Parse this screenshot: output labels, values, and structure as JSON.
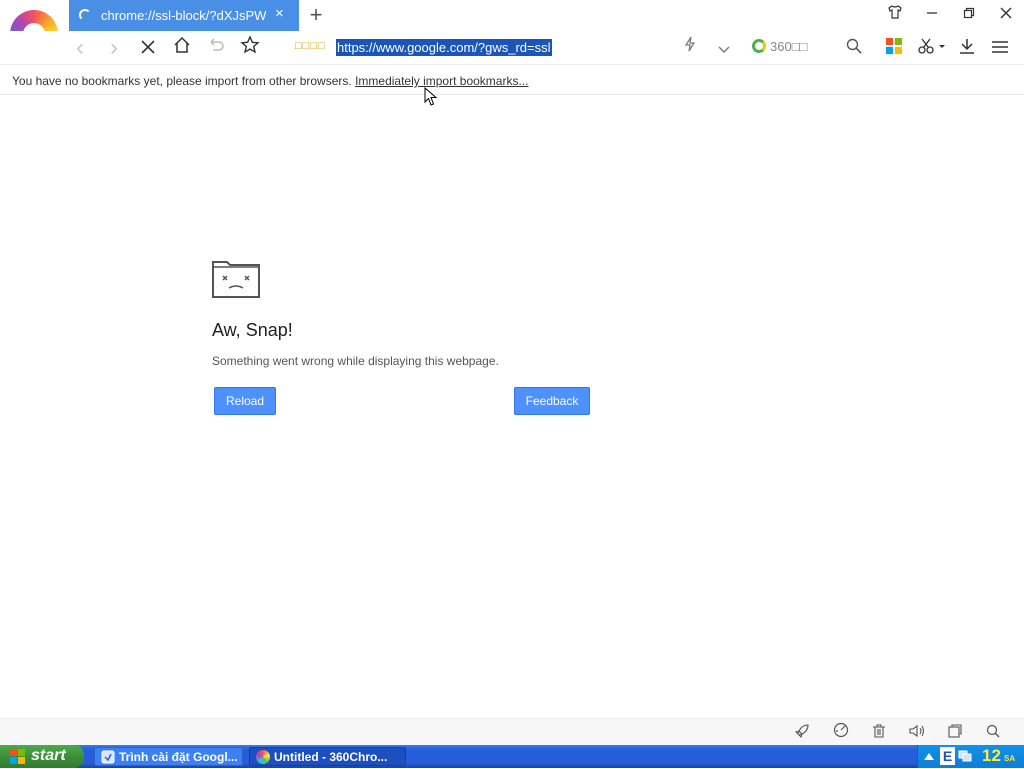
{
  "tab": {
    "title": "chrome://ssl-block/?dXJsPWh",
    "close": "×",
    "new": "+"
  },
  "window": {
    "restore_down": "❐",
    "minimize": "—",
    "maximize": "❐",
    "close": "✕",
    "skin": "👕"
  },
  "toolbar": {
    "back": "‹",
    "forward": "›",
    "stop": "✕",
    "home": "⌂",
    "undo": "↶",
    "favorite": "☆",
    "address_security": "□□□□",
    "address_url": "https://www.google.com/?gws_rd=ssl",
    "lightning": "⚡",
    "dropdown": "⌄",
    "search_engine": "360□□",
    "search": "⌕",
    "screenshot": "✂",
    "download": "⤓",
    "menu": "☰"
  },
  "bookmarks_bar": {
    "message": "You have no bookmarks yet, please import from other browsers.",
    "import_link": "Immediately import bookmarks..."
  },
  "error_page": {
    "title": "Aw, Snap!",
    "description": "Something went wrong while displaying this webpage.",
    "reload_label": "Reload",
    "feedback_label": "Feedback"
  },
  "statusbar": {
    "icons": [
      "rocket-icon",
      "speed-icon",
      "trash-icon",
      "speaker-icon",
      "window-icon",
      "zoom-icon"
    ]
  },
  "taskbar": {
    "start_label": "start",
    "tasks": [
      {
        "label": "Trình cài đặt Googl..."
      },
      {
        "label": "Untitled - 360Chro..."
      }
    ],
    "tray": {
      "time": "12",
      "ampm": "SA",
      "letter": "E"
    }
  },
  "colors": {
    "tab_active": "#4a8fe6",
    "button_blue": "#4d90fe",
    "selection": "#1a56b8",
    "taskbar": "#245edb",
    "start": "#3c8f3a"
  }
}
